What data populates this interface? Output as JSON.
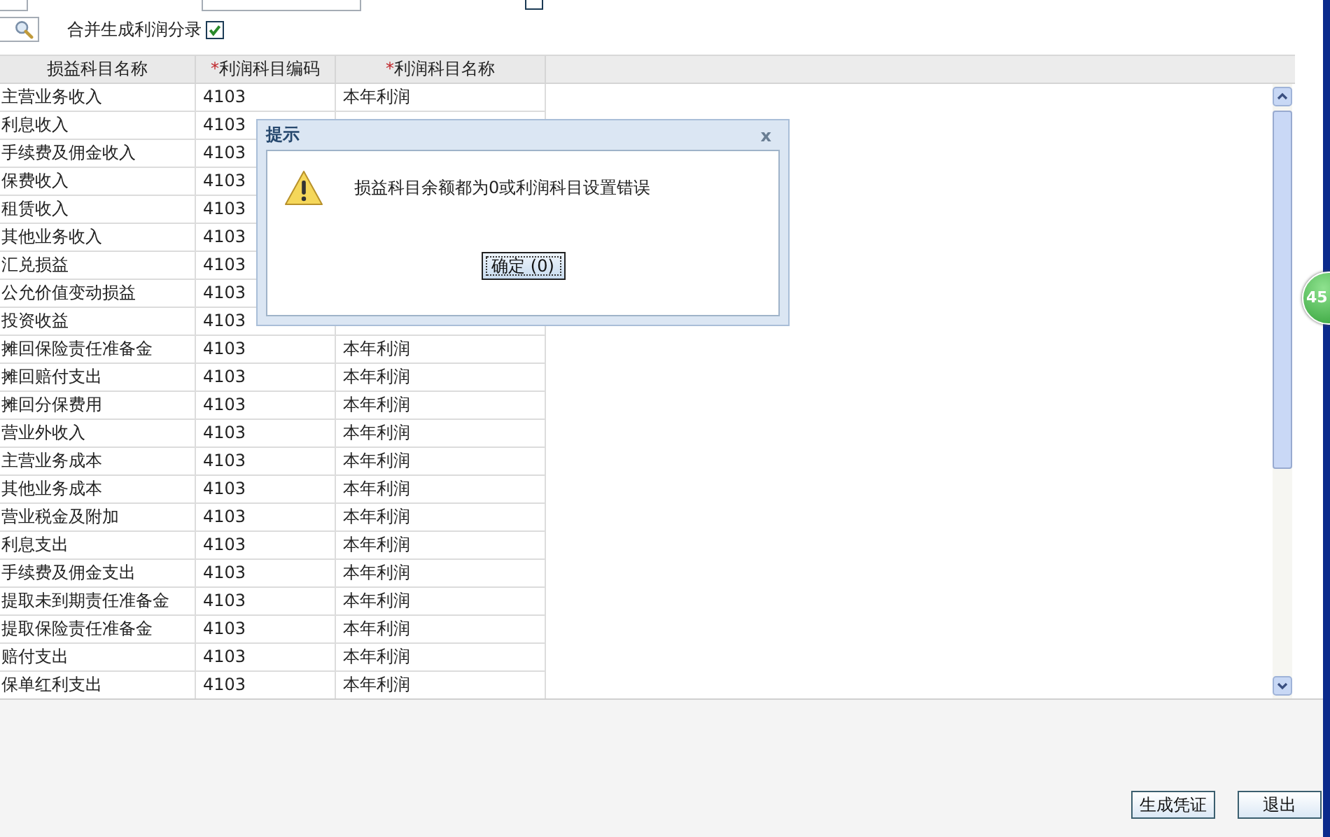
{
  "filter_row_1": {
    "separate_checked": false
  },
  "filter_row_2": {
    "merge_label": "合并生成利润分录",
    "merge_checked": true
  },
  "table": {
    "columns": [
      {
        "label": "损益科目名称"
      },
      {
        "label": "利润科目编码",
        "mark": "*"
      },
      {
        "label": "利润科目名称",
        "mark": "*"
      }
    ],
    "rows": [
      [
        "主营业务收入",
        "4103",
        "本年利润"
      ],
      [
        "利息收入",
        "4103",
        null
      ],
      [
        "手续费及佣金收入",
        "4103",
        null
      ],
      [
        "保费收入",
        "4103",
        null
      ],
      [
        "租赁收入",
        "4103",
        null
      ],
      [
        "其他业务收入",
        "4103",
        null
      ],
      [
        "汇兑损益",
        "4103",
        null
      ],
      [
        "公允价值变动损益",
        "4103",
        null
      ],
      [
        "投资收益",
        "4103",
        null
      ],
      [
        "摊回保险责任准备金",
        "4103",
        "本年利润"
      ],
      [
        "摊回赔付支出",
        "4103",
        "本年利润"
      ],
      [
        "摊回分保费用",
        "4103",
        "本年利润"
      ],
      [
        "营业外收入",
        "4103",
        "本年利润"
      ],
      [
        "主营业务成本",
        "4103",
        "本年利润"
      ],
      [
        "其他业务成本",
        "4103",
        "本年利润"
      ],
      [
        "营业税金及附加",
        "4103",
        "本年利润"
      ],
      [
        "利息支出",
        "4103",
        "本年利润"
      ],
      [
        "手续费及佣金支出",
        "4103",
        "本年利润"
      ],
      [
        "提取未到期责任准备金",
        "4103",
        "本年利润"
      ],
      [
        "提取保险责任准备金",
        "4103",
        "本年利润"
      ],
      [
        "赔付支出",
        "4103",
        "本年利润"
      ],
      [
        "保单红利支出",
        "4103",
        "本年利润"
      ]
    ]
  },
  "dialog": {
    "title": "提示",
    "close": "x",
    "message": "损益科目余额都为0或利润科目设置错误",
    "button": "确定 (0)"
  },
  "buttons": [
    "生成凭证",
    "退出"
  ],
  "badge": "45"
}
